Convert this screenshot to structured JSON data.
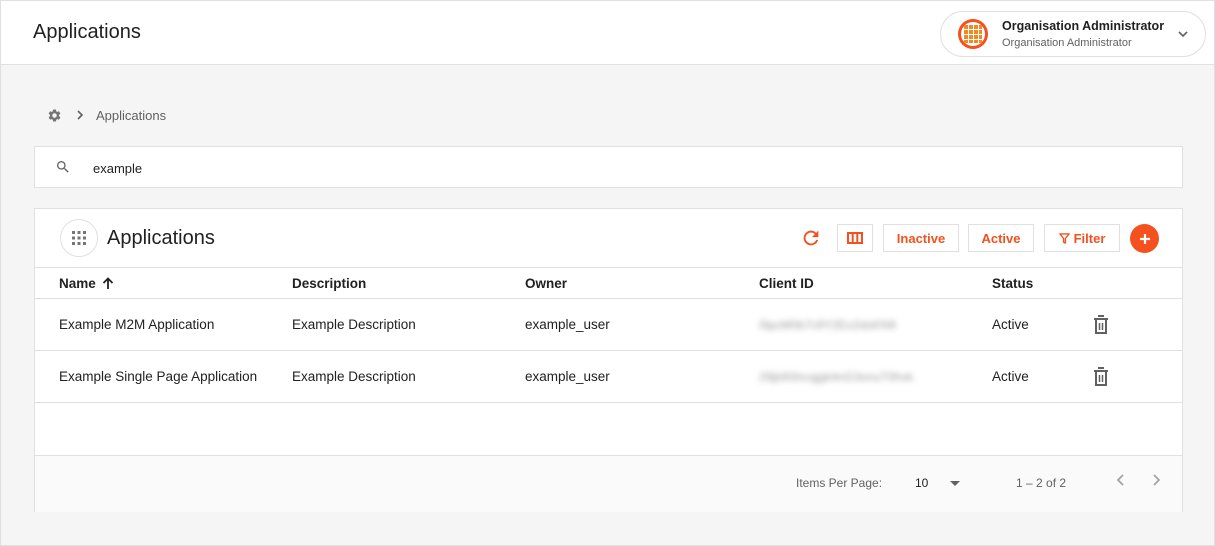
{
  "header": {
    "title": "Applications",
    "user": {
      "name": "Organisation Administrator",
      "role": "Organisation Administrator",
      "avatar_icon": "orange-grid-logo"
    }
  },
  "breadcrumb": {
    "root_icon": "gear-icon",
    "current": "Applications"
  },
  "search": {
    "value": "example",
    "placeholder": ""
  },
  "card": {
    "title": "Applications",
    "toolbar": {
      "inactive_label": "Inactive",
      "active_label": "Active",
      "filter_label": "Filter"
    },
    "columns": [
      "Name",
      "Description",
      "Owner",
      "Client ID",
      "Status"
    ],
    "sort": {
      "column": "Name",
      "direction": "ascending"
    },
    "rows": [
      {
        "name": "Example M2M Application",
        "description": "Example Description",
        "owner": "example_user",
        "client_id": "0lpcM0b7c9Y2Eo2dsKN9",
        "status": "Active"
      },
      {
        "name": "Example Single Page Application",
        "description": "Example Description",
        "owner": "example_user",
        "client_id": "29jb9Shcqjgk4nG3onuT0hvk",
        "status": "Active"
      }
    ]
  },
  "paginator": {
    "items_per_page_label": "Items Per Page:",
    "page_size": "10",
    "range_label": "1 – 2 of 2"
  },
  "colors": {
    "accent": "#f4511e",
    "border": "#e0e0e0",
    "background": "#f5f5f5"
  }
}
